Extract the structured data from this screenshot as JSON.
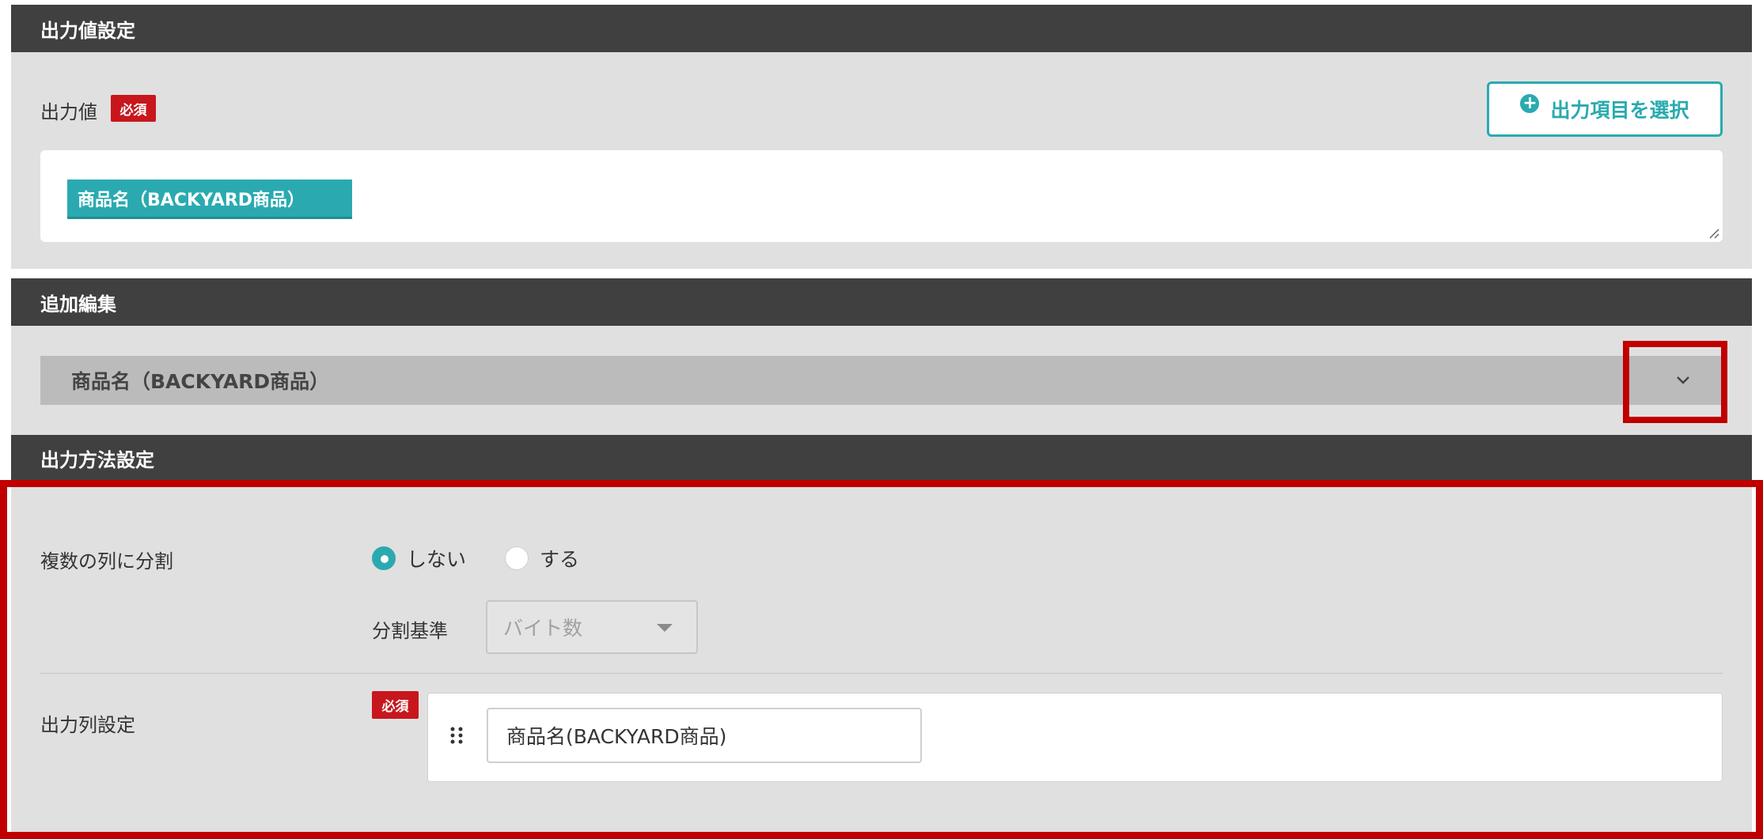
{
  "output_value_section": {
    "header": "出力値設定",
    "field_label": "出力値",
    "required_badge": "必須",
    "select_button_label": "出力項目を選択",
    "selected_chip": "商品名（BACKYARD商品）"
  },
  "additional_edit_section": {
    "header": "追加編集",
    "accordion_title": "商品名（BACKYARD商品）"
  },
  "output_method_section": {
    "header": "出力方法設定",
    "split_label": "複数の列に分割",
    "split_options": [
      {
        "label": "しない",
        "checked": true
      },
      {
        "label": "する",
        "checked": false
      }
    ],
    "split_basis_label": "分割基準",
    "split_basis_value": "バイト数",
    "column_setting_label": "出力列設定",
    "required_badge": "必須",
    "column_value": "商品名(BACKYARD商品)"
  },
  "colors": {
    "accent": "#2aaab0",
    "required": "#c8161d",
    "header_bg": "#404040",
    "highlight_border": "#c00000"
  }
}
